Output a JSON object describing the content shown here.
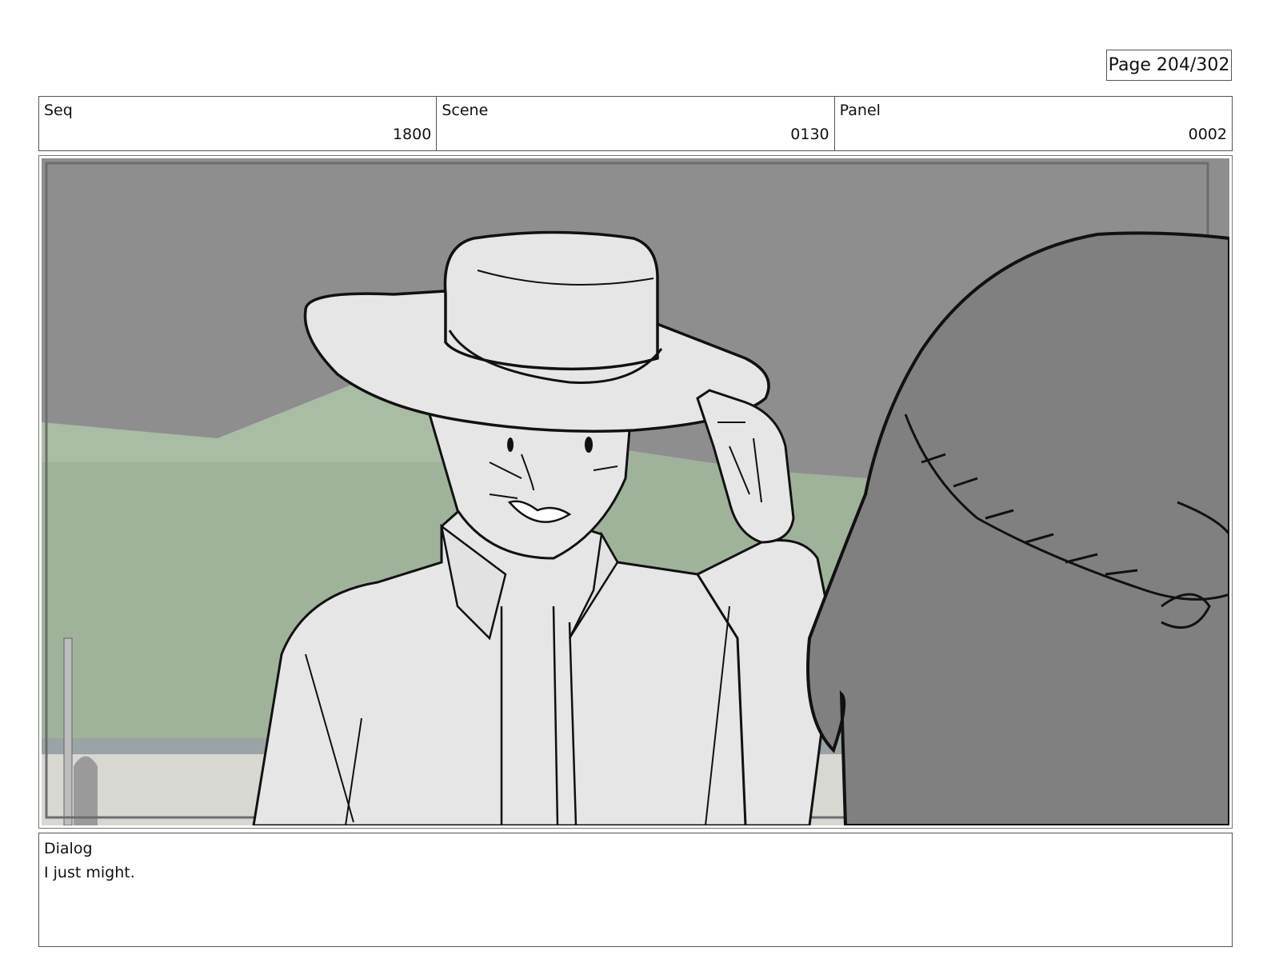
{
  "page": {
    "label": "Page 204/302"
  },
  "header": {
    "seq": {
      "label": "Seq",
      "value": "1800"
    },
    "scene": {
      "label": "Scene",
      "value": "0130"
    },
    "panel": {
      "label": "Panel",
      "value": "0002"
    }
  },
  "dialog": {
    "label": "Dialog",
    "text": "I just might."
  },
  "colors": {
    "sky": "#8e8e8e",
    "hill": "#9fb39a",
    "figure_fill": "#e6e6e6",
    "hair": "#808080",
    "line": "#111111"
  }
}
